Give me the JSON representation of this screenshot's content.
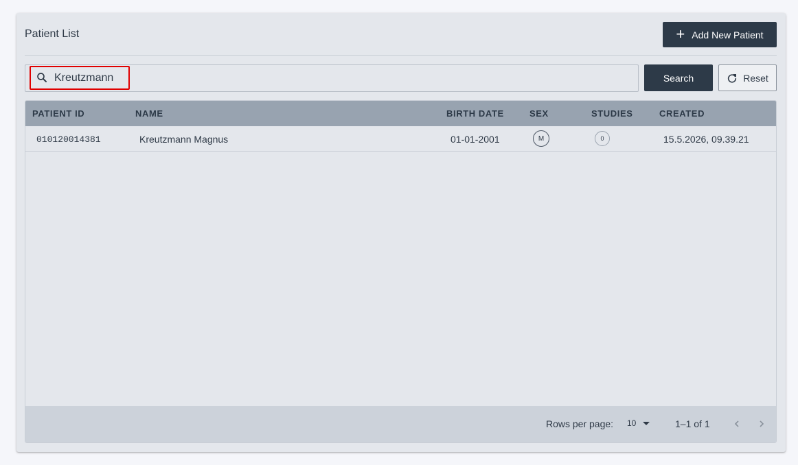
{
  "header": {
    "title": "Patient List",
    "add_button_label": "Add New Patient"
  },
  "search": {
    "value": "Kreutzmann",
    "placeholder": "",
    "search_button_label": "Search",
    "reset_button_label": "Reset"
  },
  "table": {
    "columns": [
      "PATIENT ID",
      "NAME",
      "BIRTH DATE",
      "SEX",
      "STUDIES",
      "CREATED"
    ],
    "rows": [
      {
        "patient_id": "010120014381",
        "name": "Kreutzmann Magnus",
        "birth_date": "01-01-2001",
        "sex": "M",
        "studies": "0",
        "created": "15.5.2026, 09.39.21"
      }
    ]
  },
  "pagination": {
    "rows_per_page_label": "Rows per page:",
    "rows_per_page_value": "10",
    "range_text": "1–1 of 1"
  },
  "colors": {
    "primary_dark": "#2d3a48",
    "header_bg": "#98a3b0",
    "highlight": "#e00000"
  }
}
